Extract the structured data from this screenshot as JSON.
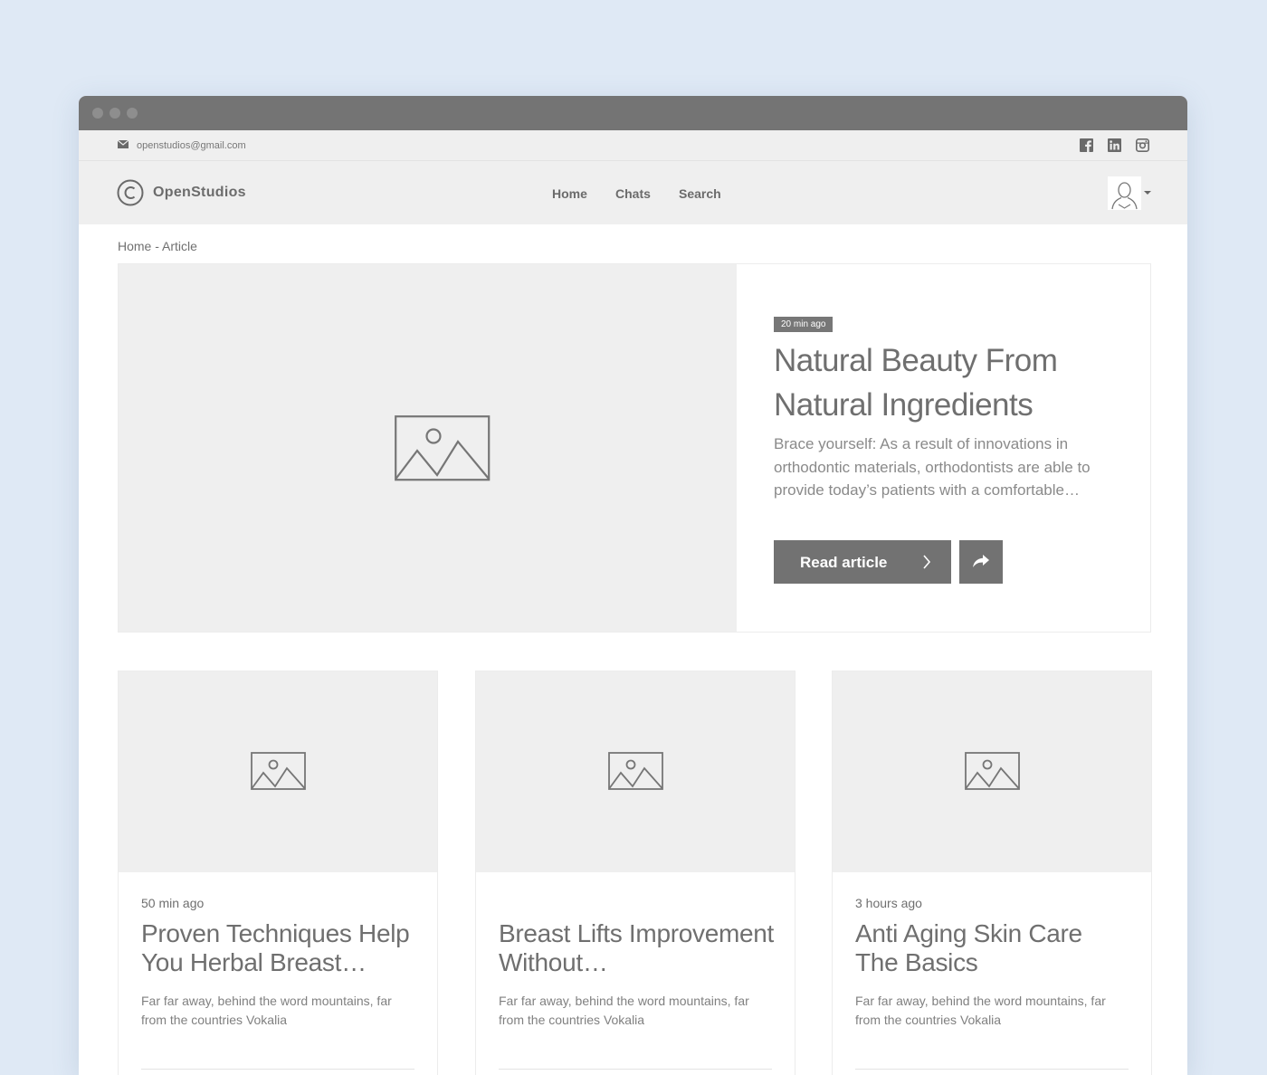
{
  "topbar": {
    "email": "openstudios@gmail.com",
    "social": [
      "facebook-icon",
      "linkedin-icon",
      "instagram-icon"
    ]
  },
  "navbar": {
    "logo": "OpenStudios",
    "links": [
      "Home",
      "Chats",
      "Search"
    ]
  },
  "breadcrumb": "Home - Article",
  "hero": {
    "badge": "20 min ago",
    "title": "Natural Beauty From Natural Ingredients",
    "description": "Brace yourself: As a result of innovations in orthodontic materials, orthodontists are able to provide today’s patients with a comfortable…",
    "read_label": "Read article"
  },
  "cards": [
    {
      "time": "50 min ago",
      "title": "Proven Techniques Help You Herbal Breast…",
      "description": "Far far away, behind the word mountains, far from the countries Vokalia"
    },
    {
      "time": "",
      "title": "Breast Lifts Improvement Without…",
      "description": "Far far away, behind the word mountains, far from the countries Vokalia"
    },
    {
      "time": "3 hours ago",
      "title": "Anti Aging Skin Care The Basics",
      "description": "Far far away, behind the word mountains, far from the countries Vokalia"
    }
  ],
  "colors": {
    "page_background": "#dfe9f5",
    "titlebar": "#747474",
    "header_background": "#efefef",
    "button": "#727272",
    "text": "#6f6f6f"
  }
}
